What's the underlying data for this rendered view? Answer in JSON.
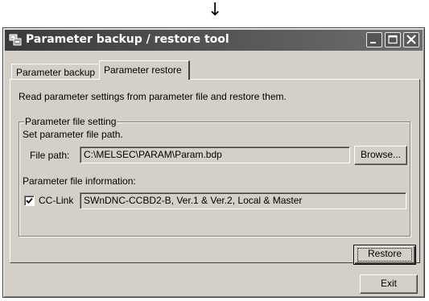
{
  "arrow": "↓",
  "window": {
    "title": "Parameter backup / restore tool",
    "controls": {
      "minimize_icon": "minimize-icon",
      "maximize_icon": "maximize-icon",
      "close_icon": "close-icon"
    }
  },
  "tabs": [
    {
      "label": "Parameter backup",
      "selected": false
    },
    {
      "label": "Parameter restore",
      "selected": true
    }
  ],
  "restore": {
    "description": "Read parameter settings from parameter file and restore them.",
    "group_title": "Parameter file setting",
    "set_path_label": "Set parameter file path.",
    "file_path_label": "File path:",
    "file_path_value": "C:\\MELSEC\\PARAM\\Param.bdp",
    "browse_label": "Browse...",
    "info_label": "Parameter file information:",
    "cclink": {
      "checked": true,
      "label": "CC-Link",
      "value": "SWnDNC-CCBD2-B, Ver.1 & Ver.2, Local & Master"
    },
    "restore_label": "Restore"
  },
  "exit_label": "Exit",
  "colors": {
    "face": "#d4d0c8",
    "titlebar_start": "#3a3a3a",
    "titlebar_end": "#6e6e6e"
  }
}
